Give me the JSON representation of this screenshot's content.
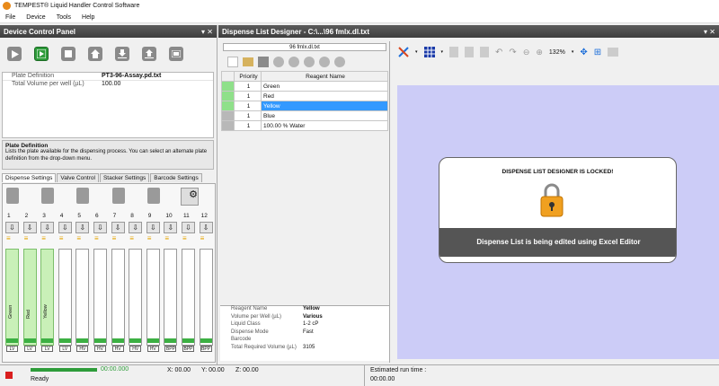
{
  "window": {
    "title": "TEMPEST® Liquid Handler Control Software"
  },
  "menu": [
    "File",
    "Device",
    "Tools",
    "Help"
  ],
  "left": {
    "header": "Device Control Panel",
    "pin": "▾ ✕",
    "properties": [
      {
        "name": "Plate Definition",
        "value": "PT3-96-Assay.pd.txt"
      },
      {
        "name": "Total Volume per well (µL)",
        "value": "100.00"
      }
    ],
    "desc_title": "Plate Definition",
    "desc_text": "Lists the plate available for the dispensing process. You can select an alternate plate definition from the drop-down menu.",
    "tabs": [
      "Dispense Settings",
      "Valve Control",
      "Stacker Settings",
      "Barcode Settings"
    ],
    "channels": [
      {
        "num": "1",
        "label": "Green",
        "type": "LV",
        "green": true
      },
      {
        "num": "2",
        "label": "Red",
        "type": "LV",
        "green": true
      },
      {
        "num": "3",
        "label": "Yellow",
        "type": "LV",
        "green": true
      },
      {
        "num": "4",
        "label": "",
        "type": "LV",
        "green": false
      },
      {
        "num": "5",
        "label": "",
        "type": "HV",
        "green": false
      },
      {
        "num": "6",
        "label": "",
        "type": "HV",
        "green": false
      },
      {
        "num": "7",
        "label": "",
        "type": "HV",
        "green": false
      },
      {
        "num": "8",
        "label": "",
        "type": "HV",
        "green": false
      },
      {
        "num": "9",
        "label": "",
        "type": "HV",
        "green": false
      },
      {
        "num": "10",
        "label": "",
        "type": "BPP",
        "green": false
      },
      {
        "num": "11",
        "label": "",
        "type": "BPP",
        "green": false
      },
      {
        "num": "12",
        "label": "",
        "type": "BPP",
        "green": false
      }
    ]
  },
  "right": {
    "header": "Dispense List Designer - C:\\...\\96 fmlx.dl.txt",
    "pin": "▾ ✕",
    "file_tab": "96 fmlx.dl.txt",
    "zoom": "132%",
    "grid_headers": [
      "Priority",
      "Reagent Name"
    ],
    "rows": [
      {
        "priority": "1",
        "name": "Green",
        "selected": false
      },
      {
        "priority": "1",
        "name": "Red",
        "selected": false
      },
      {
        "priority": "1",
        "name": "Yellow",
        "selected": true
      },
      {
        "priority": "1",
        "name": "Blue",
        "selected": false
      },
      {
        "priority": "1",
        "name": "100.00 % Water",
        "selected": false
      }
    ],
    "details": [
      {
        "k": "Reagent Name",
        "v": "Yellow"
      },
      {
        "k": "Volume per Well (µL)",
        "v": "Various"
      },
      {
        "k": "Liquid Class",
        "v": "1-2 cP"
      },
      {
        "k": "Dispense Mode",
        "v": "Fast"
      },
      {
        "k": "Barcode",
        "v": ""
      },
      {
        "k": "Total Required Volume (µL)",
        "v": "3105"
      }
    ],
    "lock_title": "DISPENSE LIST DESIGNER IS LOCKED!",
    "lock_msg": "Dispense List is being edited using Excel Editor"
  },
  "status": {
    "progress_time": "00:00.000",
    "ready": "Ready",
    "x": "X: 00.00",
    "y": "Y: 00.00",
    "z": "Z: 00.00",
    "run_label": "Estimated run time :",
    "run_time": "00:00.00"
  }
}
